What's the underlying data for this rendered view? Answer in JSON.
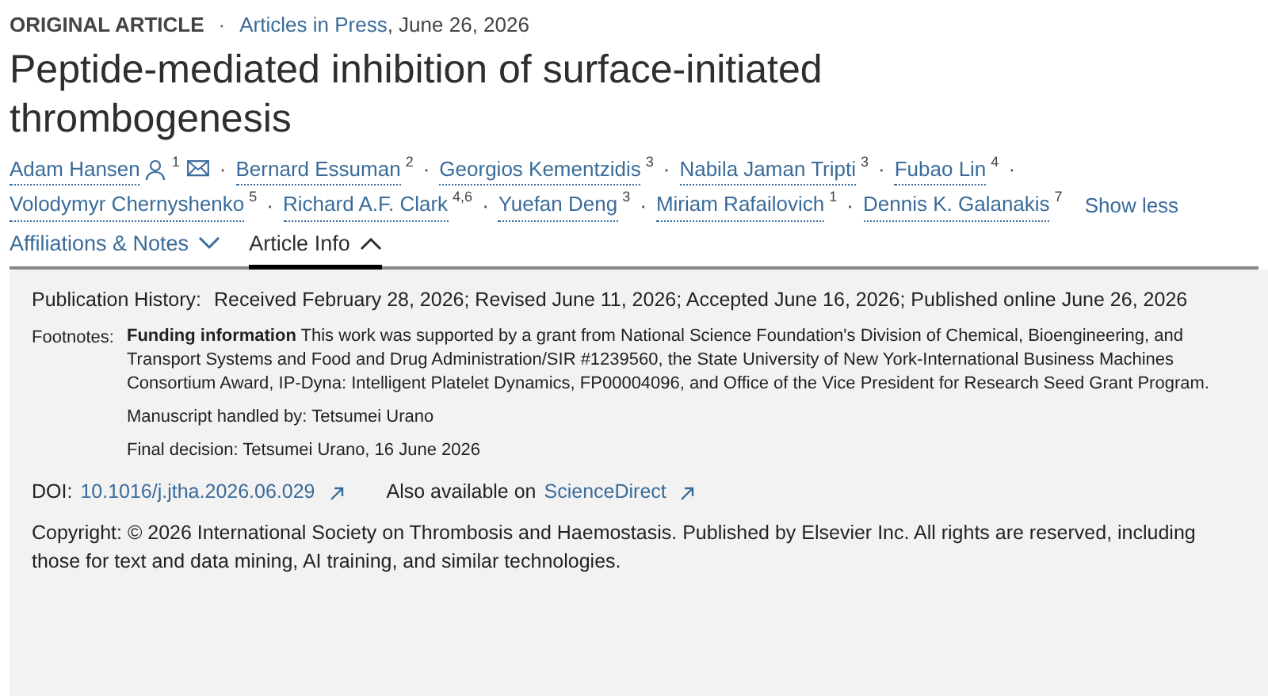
{
  "header": {
    "article_type": "ORIGINAL ARTICLE",
    "separator": "·",
    "section_link": "Articles in Press",
    "date": ", June 26, 2026"
  },
  "title": "Peptide-mediated inhibition of surface-initiated thrombogenesis",
  "author_lines": [
    [
      {
        "name": "Adam Hansen",
        "sup": "1",
        "corresponding": true,
        "sep": "·"
      },
      {
        "name": "Bernard Essuman",
        "sup": "2",
        "corresponding": false,
        "sep": "·"
      },
      {
        "name": "Georgios Kementzidis",
        "sup": "3",
        "corresponding": false,
        "sep": "·"
      },
      {
        "name": "Nabila Jaman Tripti",
        "sup": "3",
        "corresponding": false,
        "sep": "·"
      },
      {
        "name": "Fubao Lin",
        "sup": "4",
        "corresponding": false,
        "sep": "·"
      }
    ],
    [
      {
        "name": "Volodymyr Chernyshenko",
        "sup": "5",
        "corresponding": false,
        "sep": "·"
      },
      {
        "name": "Richard A.F. Clark",
        "sup": "4,6",
        "corresponding": false,
        "sep": "·"
      },
      {
        "name": "Yuefan Deng",
        "sup": "3",
        "corresponding": false,
        "sep": "·"
      },
      {
        "name": "Miriam Rafailovich",
        "sup": "1",
        "corresponding": false,
        "sep": "·"
      },
      {
        "name": "Dennis K. Galanakis",
        "sup": "7",
        "corresponding": false
      }
    ]
  ],
  "show_less": "Show less",
  "tabs": [
    {
      "label": "Affiliations & Notes",
      "selected": false,
      "expanded": false
    },
    {
      "label": "Article Info",
      "selected": true,
      "expanded": true
    }
  ],
  "info": {
    "history_label": "Publication History:",
    "history": "Received February 28, 2026; Revised June 11, 2026; Accepted June 16, 2026; Published online June 26, 2026",
    "footnotes_label": "Footnotes:",
    "funding": "**Funding information** This work was supported by a grant from National Science Foundation's Division of Chemical, Bioengineering, and Transport Systems and Food and Drug Administration/SIR #1239560, the State University of New York-International Business Machines Consortium Award, IP-Dyna: Intelligent Platelet Dynamics, FP00004096, and Office of the Vice President for Research Seed Grant Program.",
    "handled_by": "Manuscript handled by: Tetsumei Urano",
    "final_decision": "Final decision: Tetsumei Urano, 16 June 2026",
    "doi_label": "DOI:",
    "doi": "10.1016/j.jtha.2026.06.029",
    "also_label": "Also available on",
    "also_link": "ScienceDirect",
    "copyright": "Copyright: © 2026 International Society on Thrombosis and Haemostasis. Published by Elsevier Inc. All rights are reserved, including those for text and data mining, AI training, and similar technologies."
  }
}
